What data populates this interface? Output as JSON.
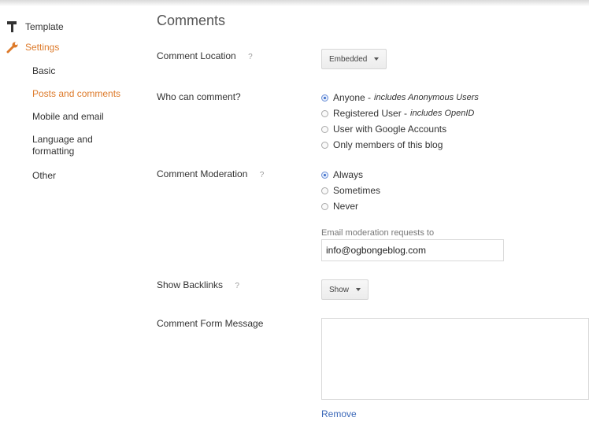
{
  "sidebar": {
    "template_label": "Template",
    "settings_label": "Settings",
    "items": [
      {
        "label": "Basic"
      },
      {
        "label": "Posts and comments"
      },
      {
        "label": "Mobile and email"
      },
      {
        "label": "Language and formatting"
      },
      {
        "label": "Other"
      }
    ]
  },
  "main": {
    "title": "Comments",
    "comment_location": {
      "label": "Comment Location",
      "help": "?",
      "value": "Embedded"
    },
    "who_can_comment": {
      "label": "Who can comment?",
      "options": [
        {
          "text": "Anyone - ",
          "note": "includes Anonymous Users",
          "checked": true
        },
        {
          "text": "Registered User - ",
          "note": "includes OpenID",
          "checked": false
        },
        {
          "text": "User with Google Accounts",
          "note": "",
          "checked": false
        },
        {
          "text": "Only members of this blog",
          "note": "",
          "checked": false
        }
      ]
    },
    "comment_moderation": {
      "label": "Comment Moderation",
      "help": "?",
      "options": [
        {
          "text": "Always",
          "checked": true
        },
        {
          "text": "Sometimes",
          "checked": false
        },
        {
          "text": "Never",
          "checked": false
        }
      ],
      "email_caption": "Email moderation requests to",
      "email_value": "info@ogbongeblog.com"
    },
    "show_backlinks": {
      "label": "Show Backlinks",
      "help": "?",
      "value": "Show"
    },
    "comment_form_message": {
      "label": "Comment Form Message",
      "value": ""
    },
    "remove_label": "Remove"
  },
  "colors": {
    "accent": "#dd7a2a",
    "link": "#3b68b8"
  }
}
